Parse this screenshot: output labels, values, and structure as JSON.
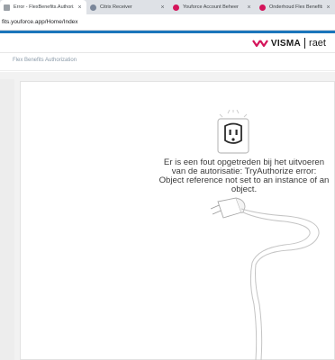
{
  "browser": {
    "tabs": [
      {
        "title": "Error - FlexBenefits.Authorizati...",
        "active": true,
        "favicon": "error-page-icon"
      },
      {
        "title": "Citrix Receiver",
        "active": false,
        "favicon": "citrix-icon"
      },
      {
        "title": "Youforce Account Beheer",
        "active": false,
        "favicon": "youforce-icon"
      },
      {
        "title": "Onderhoud Flex Benefits op 3 ...",
        "active": false,
        "favicon": "youforce-icon"
      }
    ],
    "url": "fits.youforce.app/Home/Index"
  },
  "header": {
    "logo_brand": "VISMA",
    "logo_sub": "raet",
    "accent_color": "#1b75bb"
  },
  "subheader": {
    "app_name": "Flex Benefits Authorization"
  },
  "main": {
    "error_message": "Er is een fout opgetreden bij het uitvoeren van de autorisatie: TryAuthorize error: Object reference not set to an instance of an object.",
    "illustration": "unplugged-socket-icon"
  }
}
